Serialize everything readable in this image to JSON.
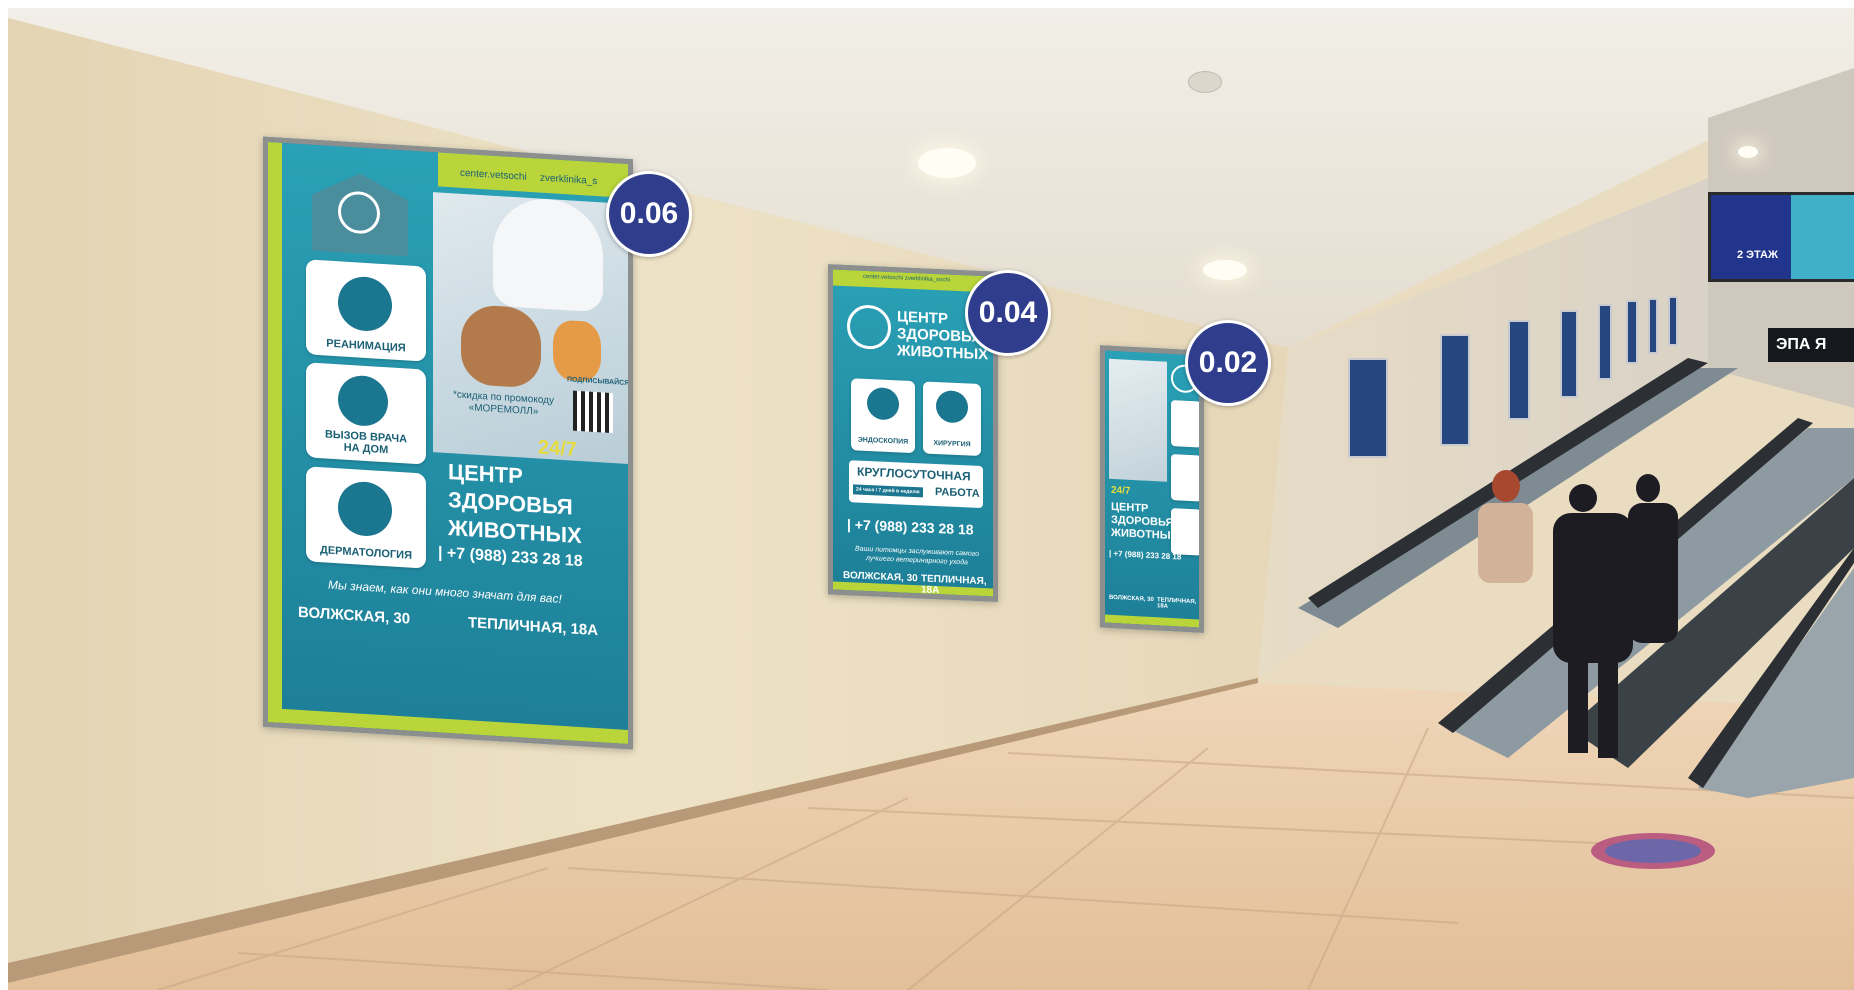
{
  "badges": [
    "0.06",
    "0.04",
    "0.02"
  ],
  "poster_large": {
    "socials": [
      "center.vetsochi",
      "zverklinika_s"
    ],
    "services": [
      "РЕАНИМАЦИЯ",
      "ВЫЗОВ ВРАЧА\nНА ДОМ",
      "ДЕРМАТОЛОГИЯ"
    ],
    "promo": "*скидка по промокоду\n«МОРЕМОЛЛ»",
    "qr_label": "ПОДПИСЫВАЙСЯ",
    "hours": "24/7",
    "title": "ЦЕНТР\nЗДОРОВЬЯ\nЖИВОТНЫХ",
    "phone": "| +7 (988) 233 28 18",
    "tagline": "Мы знаем, как они много значат для вас!",
    "address_1": "ВОЛЖСКАЯ, 30",
    "address_2": "ТЕПЛИЧНАЯ, 18А"
  },
  "poster_medium": {
    "socials": "center.vetsochi   zverklinika_sochi",
    "title": "ЦЕНТР\nЗДОРОВЬЯ\nЖИВОТНЫХ",
    "services": [
      "ЭНДОСКОПИЯ",
      "ХИРУРГИЯ"
    ],
    "banner_1": "КРУГЛОСУТОЧНАЯ",
    "banner_hours": "24 часа / 7 дней в неделю",
    "banner_2": "РАБОТА",
    "phone": "| +7 (988) 233 28 18",
    "tagline": "Ваши питомцы заслуживают самого\nлучшего ветеринарного ухода",
    "address_1": "ВОЛЖСКАЯ, 30",
    "address_2": "ТЕПЛИЧНАЯ, 18А"
  },
  "poster_small": {
    "hours": "24/7",
    "title": "ЦЕНТР\nЗДОРОВЬЯ\nЖИВОТНЫХ",
    "phone": "| +7 (988) 233 28 18",
    "address_1": "ВОЛЖСКАЯ, 30",
    "address_2": "ТЕПЛИЧНАЯ, 18А"
  },
  "screen": {
    "floor_label": "2 ЭТАЖ"
  },
  "store_sign": "ЭПА Я",
  "colors": {
    "wall": "#e9dcc0",
    "poster_teal": "#1f8fa6",
    "poster_lime": "#b9d53a",
    "badge": "#2f3d8c",
    "floor": "#e8c9a6"
  }
}
